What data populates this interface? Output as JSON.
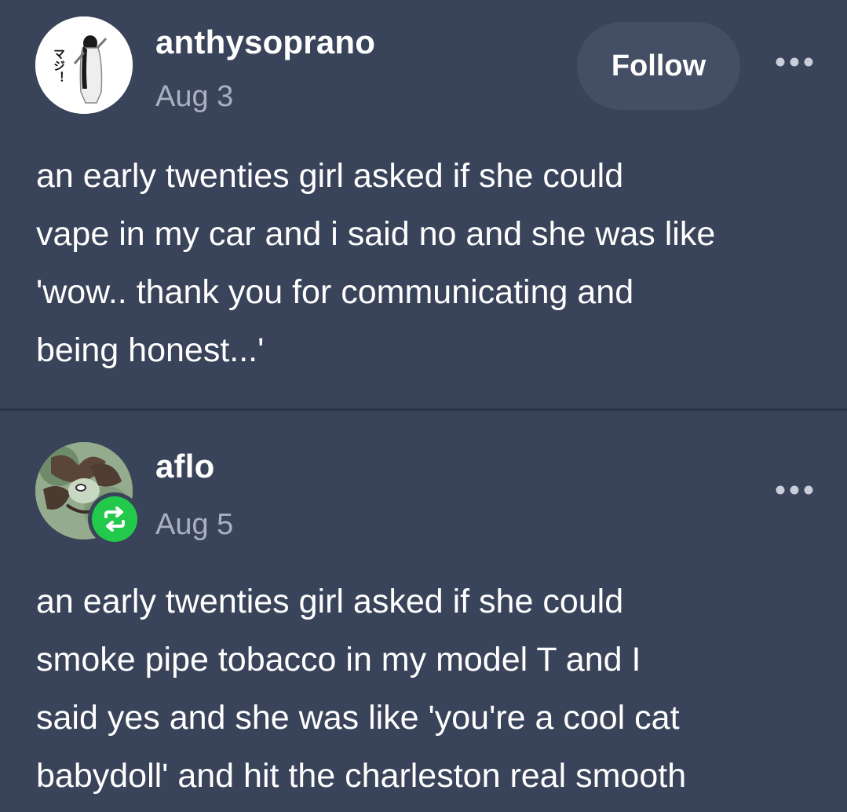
{
  "posts": [
    {
      "username": "anthysoprano",
      "date": "Aug 3",
      "avatar_text": "マジ！",
      "follow_label": "Follow",
      "lines": [
        "an early twenties girl asked if she could",
        "vape in my car and i said no and she was like",
        "'wow.. thank you for communicating and",
        "being honest...'"
      ]
    },
    {
      "username": "aflo",
      "date": "Aug 5",
      "reblog_icon": "reblog-icon",
      "lines": [
        "an early twenties girl asked if she could",
        "smoke pipe tobacco in my model T and I",
        "said yes and she was like 'you're a cool cat",
        "babydoll' and hit the charleston real smooth"
      ]
    }
  ],
  "colors": {
    "background": "#394359",
    "divider": "#2b3346",
    "follow_button": "#444e64",
    "date_text": "#a9b0bf",
    "reblog_badge": "#22c94a"
  }
}
